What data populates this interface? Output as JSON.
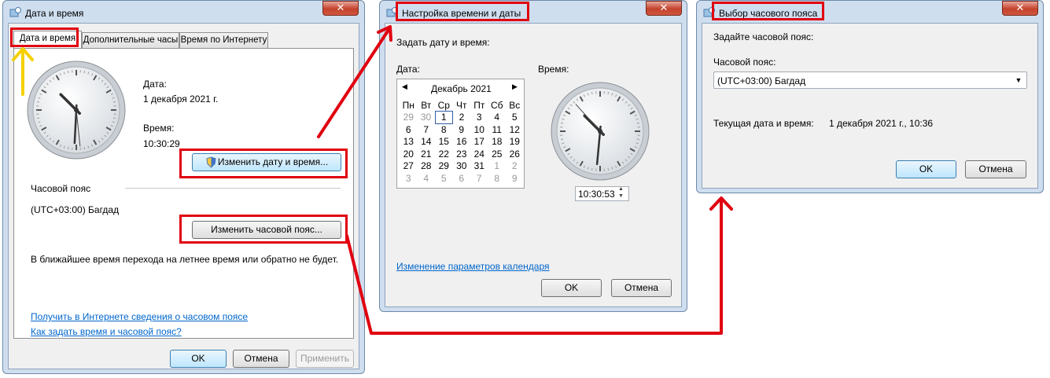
{
  "win1": {
    "title": "Дата и время",
    "close": "✕",
    "tabs": [
      "Дата и время",
      "Дополнительные часы",
      "Время по Интернету"
    ],
    "date_label": "Дата:",
    "date_value": "1 декабря 2021 г.",
    "time_label": "Время:",
    "time_value": "10:30:29",
    "change_datetime": "Изменить дату и время...",
    "tz_header": "Часовой пояс",
    "tz_value": "(UTC+03:00) Багдад",
    "change_tz": "Изменить часовой пояс...",
    "dst_note": "В ближайшее время перехода на летнее время или обратно не будет.",
    "link1": "Получить в Интернете сведения о часовом поясе",
    "link2": "Как задать время и часовой пояс?",
    "ok": "OK",
    "cancel": "Отмена",
    "apply": "Применить",
    "clock": {
      "hours": 10,
      "minutes": 30,
      "seconds": 29
    }
  },
  "win2": {
    "title": "Настройка времени и даты",
    "close": "✕",
    "heading": "Задать дату и время:",
    "date_label": "Дата:",
    "time_label": "Время:",
    "month": "Декабрь 2021",
    "weekdays": [
      "Пн",
      "Вт",
      "Ср",
      "Чт",
      "Пт",
      "Сб",
      "Вс"
    ],
    "weeks": [
      [
        "29",
        "30",
        "1",
        "2",
        "3",
        "4",
        "5"
      ],
      [
        "6",
        "7",
        "8",
        "9",
        "10",
        "11",
        "12"
      ],
      [
        "13",
        "14",
        "15",
        "16",
        "17",
        "18",
        "19"
      ],
      [
        "20",
        "21",
        "22",
        "23",
        "24",
        "25",
        "26"
      ],
      [
        "27",
        "28",
        "29",
        "30",
        "31",
        "1",
        "2"
      ],
      [
        "3",
        "4",
        "5",
        "6",
        "7",
        "8",
        "9"
      ]
    ],
    "time_value": "10:30:53",
    "calendar_link": "Изменение параметров календаря",
    "ok": "OK",
    "cancel": "Отмена",
    "clock": {
      "hours": 10,
      "minutes": 30,
      "seconds": 53
    }
  },
  "win3": {
    "title": "Выбор часового пояса",
    "close": "✕",
    "heading": "Задайте часовой пояс:",
    "tz_label": "Часовой пояс:",
    "tz_value": "(UTC+03:00) Багдад",
    "current_label": "Текущая дата и время:",
    "current_value": "1 декабря 2021 г., 10:36",
    "ok": "OK",
    "cancel": "Отмена"
  },
  "colors": {
    "annotation": "#e00010",
    "arrow_yellow": "#f5d000",
    "link": "#0066cc"
  }
}
